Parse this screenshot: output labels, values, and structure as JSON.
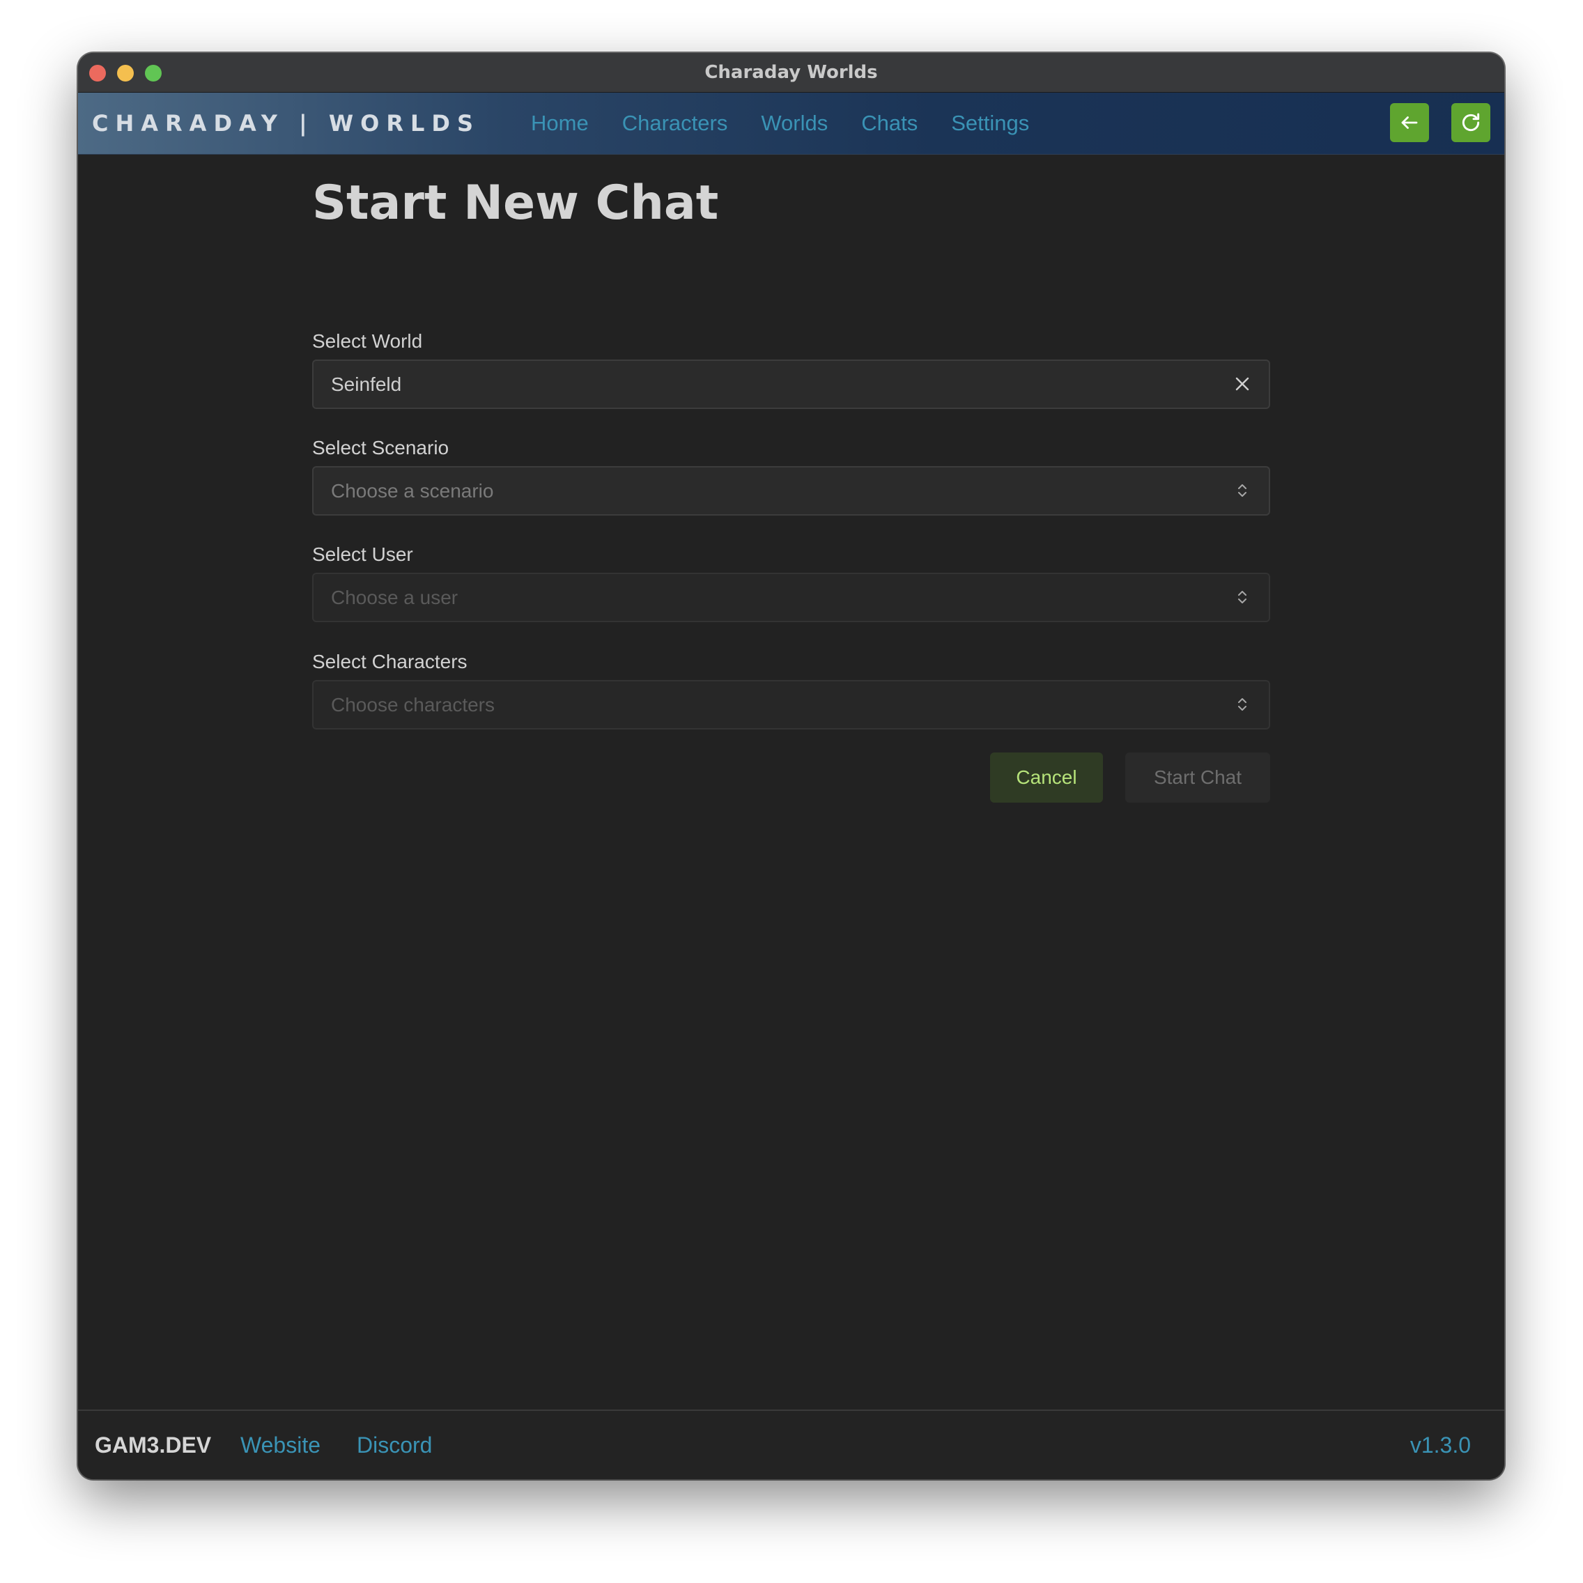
{
  "window": {
    "title": "Charaday Worlds"
  },
  "app": {
    "brand": "CHARADAY | WORLDS",
    "nav": [
      "Home",
      "Characters",
      "Worlds",
      "Chats",
      "Settings"
    ],
    "accent_color": "#5fa52f",
    "link_color": "#3a93b5",
    "toolbar_icons": [
      "arrow-left-icon",
      "refresh-icon"
    ]
  },
  "page": {
    "title": "Start New Chat"
  },
  "form": {
    "world": {
      "label": "Select World",
      "value": "Seinfeld"
    },
    "scenario": {
      "label": "Select Scenario",
      "placeholder": "Choose a scenario"
    },
    "user": {
      "label": "Select User",
      "placeholder": "Choose a user"
    },
    "characters": {
      "label": "Select Characters",
      "placeholder": "Choose characters"
    },
    "cancel_label": "Cancel",
    "start_label": "Start Chat"
  },
  "footer": {
    "brand": "GAM3.DEV",
    "website": "Website",
    "discord": "Discord",
    "version": "v1.3.0"
  }
}
